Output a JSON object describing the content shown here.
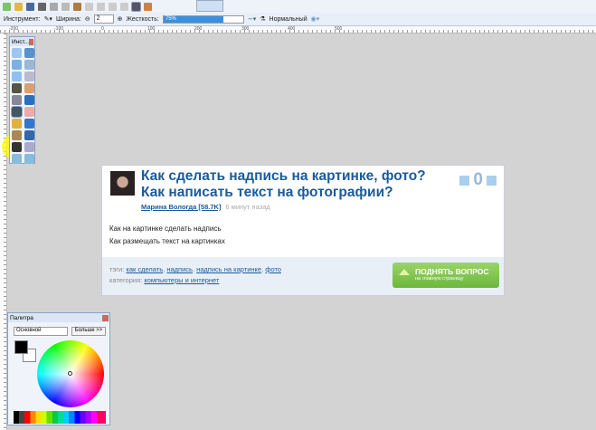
{
  "toolbar": {
    "tool_label": "Инструмент:",
    "width_label": "Ширина:",
    "width_value": "2",
    "hardness_label": "Жесткость:",
    "hardness_value": "75%",
    "hardness_percent": 75,
    "blend_mode": "Нормальный"
  },
  "ruler": {
    "top_ticks": [
      "-200",
      "-100",
      "0",
      "100",
      "200",
      "300",
      "400",
      "500"
    ]
  },
  "tools": {
    "title": "Инст..."
  },
  "question": {
    "title": "Как сделать надпись на картинке, фото? Как написать текст на фотографии?",
    "author": "Марина Вологда [58.7K]",
    "time": "6 минут назад",
    "votes": "0",
    "lines": [
      "Как на картинке сделать надпись",
      "Как размещать текст на картинках"
    ],
    "tags_label": "тэги:",
    "tags": [
      "как сделать",
      "надпись",
      "надпись на картинке",
      "фото"
    ],
    "category_label": "категория:",
    "category": "компьютеры и интернет",
    "raise_button": "ПОДНЯТЬ ВОПРОС",
    "raise_sub": "на главную страницу"
  },
  "palette": {
    "title": "Палитра",
    "mode": "Основной",
    "more_button": "Больше >>"
  }
}
